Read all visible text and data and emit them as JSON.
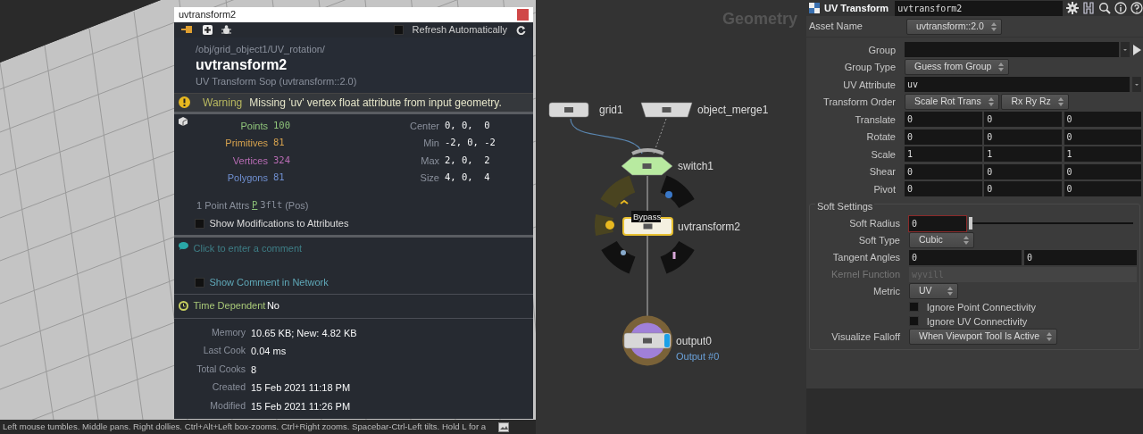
{
  "viewport": {
    "status_text": "Left mouse tumbles. Middle pans. Right dollies. Ctrl+Alt+Left box-zooms. Ctrl+Right zooms. Spacebar-Ctrl-Left tilts. Hold L for a"
  },
  "info_window": {
    "title": "uvtransform2",
    "refresh": {
      "label": "Refresh Automatically",
      "checked": false
    },
    "path": "/obj/grid_object1/UV_rotation/",
    "node_name": "uvtransform2",
    "node_type": "UV Transform Sop (uvtransform::2.0)",
    "warning": {
      "label": "Warning",
      "message": "Missing 'uv' vertex float attribute from input geometry."
    },
    "counts": [
      {
        "label": "Points",
        "value": "100",
        "color": "#8fc47a"
      },
      {
        "label": "Primitives",
        "value": "81",
        "color": "#d6a24e"
      },
      {
        "label": "Vertices",
        "value": "324",
        "color": "#b86cb4"
      },
      {
        "label": "Polygons",
        "value": "81",
        "color": "#6f8fd0"
      }
    ],
    "bounds": [
      {
        "label": "Center",
        "value": "0, 0,  0"
      },
      {
        "label": "Min",
        "value": "-2, 0, -2"
      },
      {
        "label": "Max",
        "value": "2, 0,  2"
      },
      {
        "label": "Size",
        "value": "4, 0,  4"
      }
    ],
    "attrs": {
      "label": "1 Point Attrs",
      "name": "P",
      "type": "3flt",
      "note": "(Pos)"
    },
    "show_modifications": {
      "label": "Show Modifications to Attributes",
      "checked": false
    },
    "comment": {
      "placeholder": "Click to enter a comment"
    },
    "show_comment": {
      "label": "Show Comment in Network",
      "checked": false
    },
    "time_dependent": {
      "label": "Time Dependent",
      "value": "No"
    },
    "stats": [
      {
        "label": "Memory",
        "value": "10.65 KB; New: 4.82 KB"
      },
      {
        "label": "Last Cook",
        "value": "0.04 ms"
      },
      {
        "label": "Total Cooks",
        "value": "8"
      },
      {
        "label": "Created",
        "value": "15 Feb 2021 11:18 PM"
      },
      {
        "label": "Modified",
        "value": "15 Feb 2021 11:26 PM"
      }
    ]
  },
  "network": {
    "title": "Geometry",
    "tooltip": "Bypass",
    "nodes": [
      {
        "name": "grid1",
        "kind": "generator",
        "selected": false
      },
      {
        "name": "object_merge1",
        "kind": "merge_input",
        "selected": false
      },
      {
        "name": "switch1",
        "kind": "switch",
        "selected": false
      },
      {
        "name": "uvtransform2",
        "kind": "operator",
        "selected": true
      },
      {
        "name": "output0",
        "kind": "output",
        "selected": false,
        "sublabel": "Output #0"
      }
    ]
  },
  "parameters": {
    "type_label": "UV Transform",
    "node_name": "uvtransform2",
    "asset_name": {
      "label": "Asset Name",
      "value": "uvtransform::2.0"
    },
    "rows": [
      {
        "kind": "group_field",
        "label": "Group"
      },
      {
        "kind": "menu",
        "label": "Group Type",
        "values": [
          "Guess from Group"
        ]
      },
      {
        "kind": "string_menu",
        "label": "UV Attribute",
        "value": "uv"
      },
      {
        "kind": "menu",
        "label": "Transform Order",
        "values": [
          "Scale Rot Trans",
          "Rx Ry Rz"
        ]
      },
      {
        "kind": "vector",
        "label": "Translate",
        "values": [
          "0",
          "0",
          "0"
        ]
      },
      {
        "kind": "vector",
        "label": "Rotate",
        "values": [
          "0",
          "0",
          "0"
        ]
      },
      {
        "kind": "vector",
        "label": "Scale",
        "values": [
          "1",
          "1",
          "1"
        ]
      },
      {
        "kind": "vector",
        "label": "Shear",
        "values": [
          "0",
          "0",
          "0"
        ]
      },
      {
        "kind": "vector",
        "label": "Pivot",
        "values": [
          "0",
          "0",
          "0"
        ]
      }
    ],
    "soft_settings": {
      "title": "Soft Settings",
      "rows": [
        {
          "kind": "slider",
          "label": "Soft Radius",
          "value": "0",
          "level": 0
        },
        {
          "kind": "menu",
          "label": "Soft Type",
          "values": [
            "Cubic"
          ]
        },
        {
          "kind": "vector",
          "label": "Tangent Angles",
          "values": [
            "0",
            "0"
          ]
        },
        {
          "kind": "field",
          "label": "Kernel Function",
          "value": "wyvill",
          "disabled": true
        },
        {
          "kind": "menu",
          "label": "Metric",
          "values": [
            "UV"
          ]
        },
        {
          "kind": "toggle",
          "label": "Ignore Point Connectivity",
          "checked": false
        },
        {
          "kind": "toggle",
          "label": "Ignore UV Connectivity",
          "checked": false
        },
        {
          "kind": "menu",
          "label": "Visualize Falloff",
          "values": [
            "When Viewport Tool Is Active"
          ]
        }
      ]
    }
  }
}
